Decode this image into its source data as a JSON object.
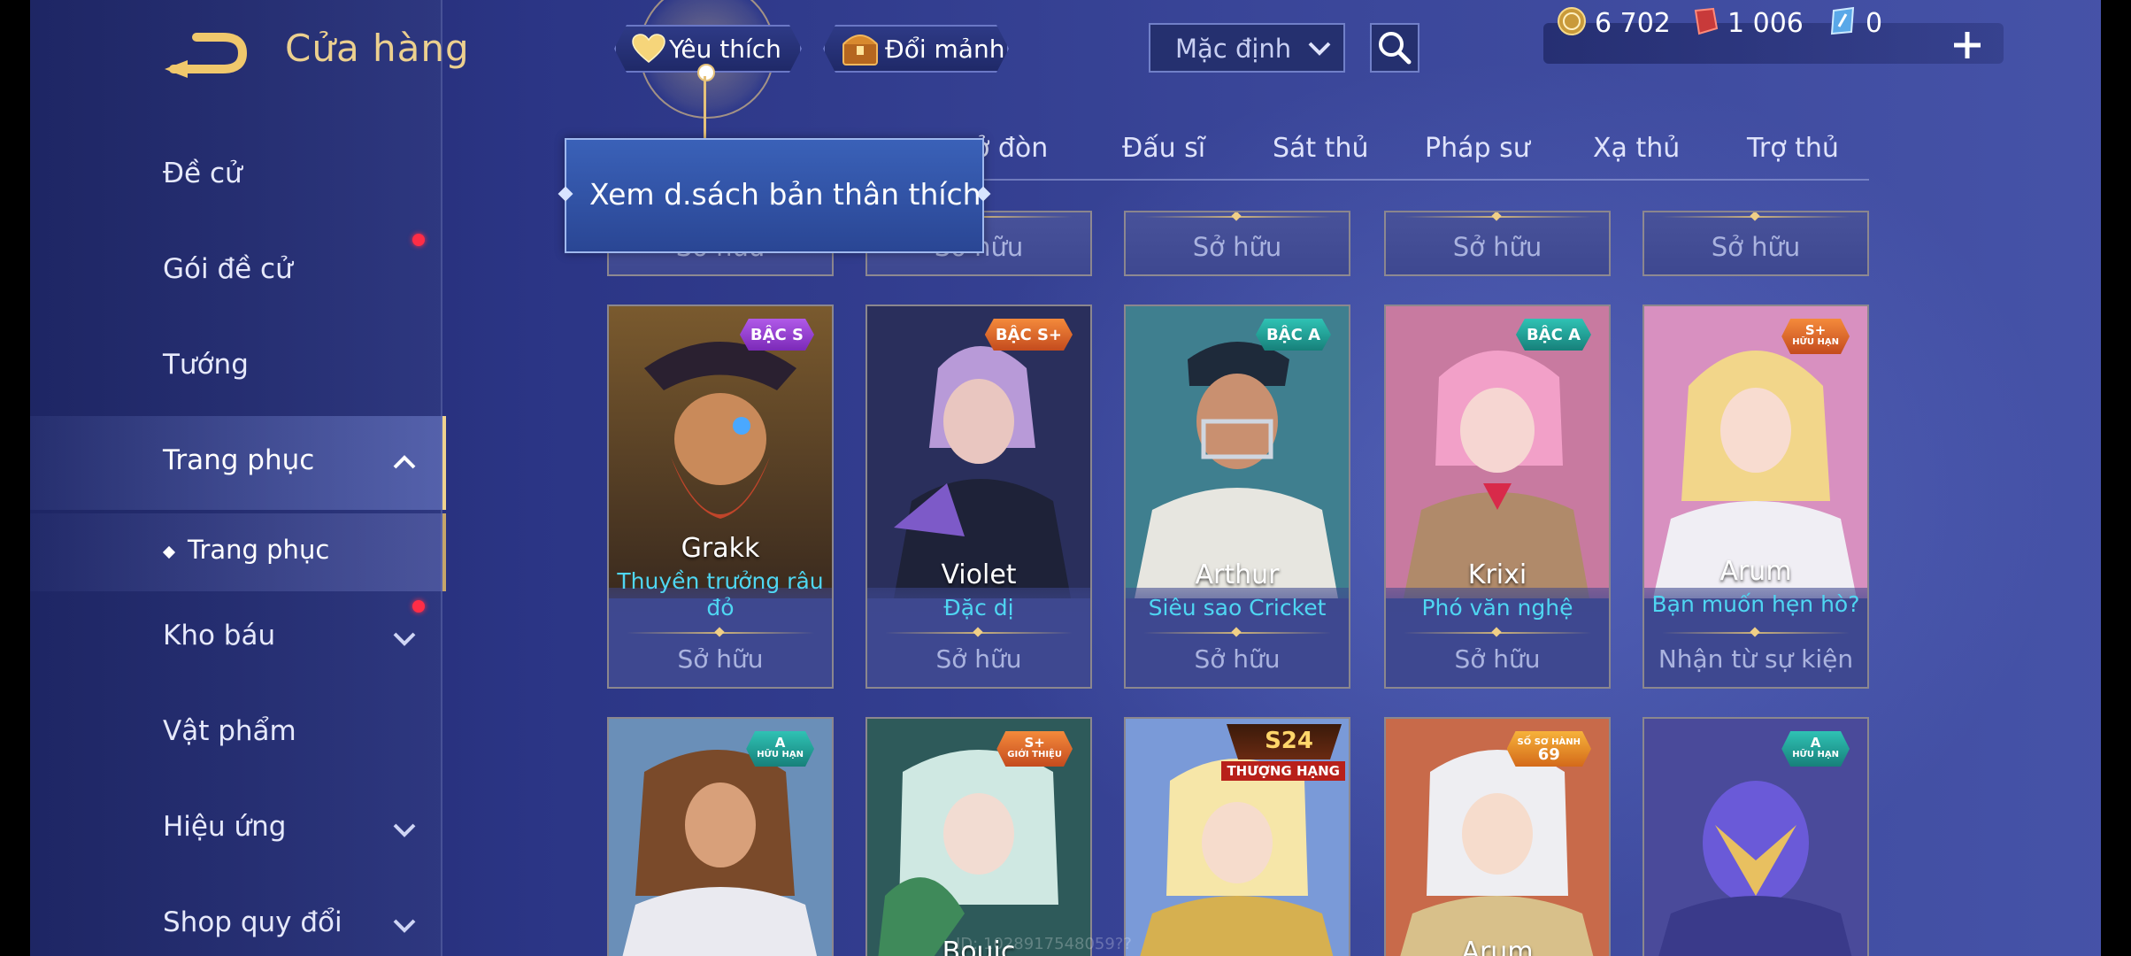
{
  "header": {
    "title": "Cửa hàng",
    "favorites_label": "Yêu thích",
    "exchange_label": "Đổi mảnh",
    "sort_value": "Mặc định"
  },
  "currency": {
    "gold": "6 702",
    "voucher": "1 006",
    "coupon": "0"
  },
  "tooltip": {
    "text": "Xem d.sách bản thân thích"
  },
  "sidebar": {
    "items": [
      {
        "label": "Đề cử"
      },
      {
        "label": "Gói đề cử"
      },
      {
        "label": "Tướng"
      },
      {
        "label": "Trang phục"
      },
      {
        "label": "Kho báu"
      },
      {
        "label": "Vật phẩm"
      },
      {
        "label": "Hiệu ứng"
      },
      {
        "label": "Shop quy đổi"
      }
    ],
    "sub_item": "Trang phục"
  },
  "tabs": [
    "ở đòn",
    "Đấu sĩ",
    "Sát thủ",
    "Pháp sư",
    "Xạ thủ",
    "Trợ thủ"
  ],
  "cut_row": [
    "Sở hữu",
    "Sở hữu",
    "Sở hữu",
    "Sở hữu",
    "Sở hữu"
  ],
  "cards": [
    {
      "hero": "Grakk",
      "skin_line1": "Thuyền trưởng râu",
      "skin_line2": "đỏ",
      "status": "Sở hữu",
      "badge": "BẬC S"
    },
    {
      "hero": "Violet",
      "skin_line1": "Đặc dị",
      "status": "Sở hữu",
      "badge": "BẬC S+"
    },
    {
      "hero": "Arthur",
      "skin_line1": "Siêu sao Cricket",
      "status": "Sở hữu",
      "badge": "BẬC A"
    },
    {
      "hero": "Krixi",
      "skin_line1": "Phó văn nghệ",
      "status": "Sở hữu",
      "badge": "BẬC A"
    },
    {
      "hero": "Arum",
      "skin_line1": "Bạn muốn hẹn hò?",
      "status": "Nhận từ sự kiện",
      "badge": "S+",
      "badge_sub": "HỮU HẠN"
    }
  ],
  "row3": [
    {
      "badge": "A",
      "badge_sub": "HỮU HẠN"
    },
    {
      "hero": "Bouic",
      "badge": "S+",
      "badge_sub": "GIỚI THIỆU"
    },
    {
      "rank": "S24",
      "rank_sub": "THƯỢNG HẠNG"
    },
    {
      "hero": "Arum",
      "badge": "SỐ SƠ HÀNH",
      "badge_sub": "69"
    },
    {
      "badge": "A",
      "badge_sub": "HỮU HẠN"
    }
  ],
  "watermark": "ID: 1028917548059??",
  "colors": {
    "accent_gold": "#ecd08f",
    "skin_name": "#4fd6f2",
    "notify_dot": "#ff2d46"
  }
}
